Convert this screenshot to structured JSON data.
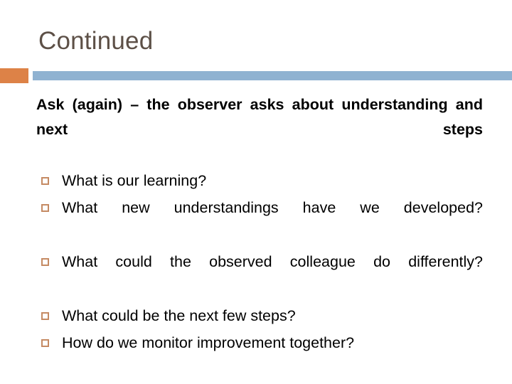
{
  "slide": {
    "title": "Continued",
    "colors": {
      "accent_orange": "#dd8247",
      "accent_blue": "#8fb2d1",
      "title_text": "#5d5047",
      "bullet_marker": "#c58a63",
      "body_text": "#000000",
      "background": "#ffffff"
    },
    "lead_paragraph": "Ask (again) – the observer asks about understanding and next steps",
    "bullets": [
      {
        "text": "What is our learning?",
        "wraps": false
      },
      {
        "text": "What new understandings have we developed?",
        "wraps": true
      },
      {
        "text": "What could the observed colleague do differently?",
        "wraps": true
      },
      {
        "text": "What could be the next few steps?",
        "wraps": false
      },
      {
        "text": "How do we monitor improvement together?",
        "wraps": false
      }
    ]
  }
}
